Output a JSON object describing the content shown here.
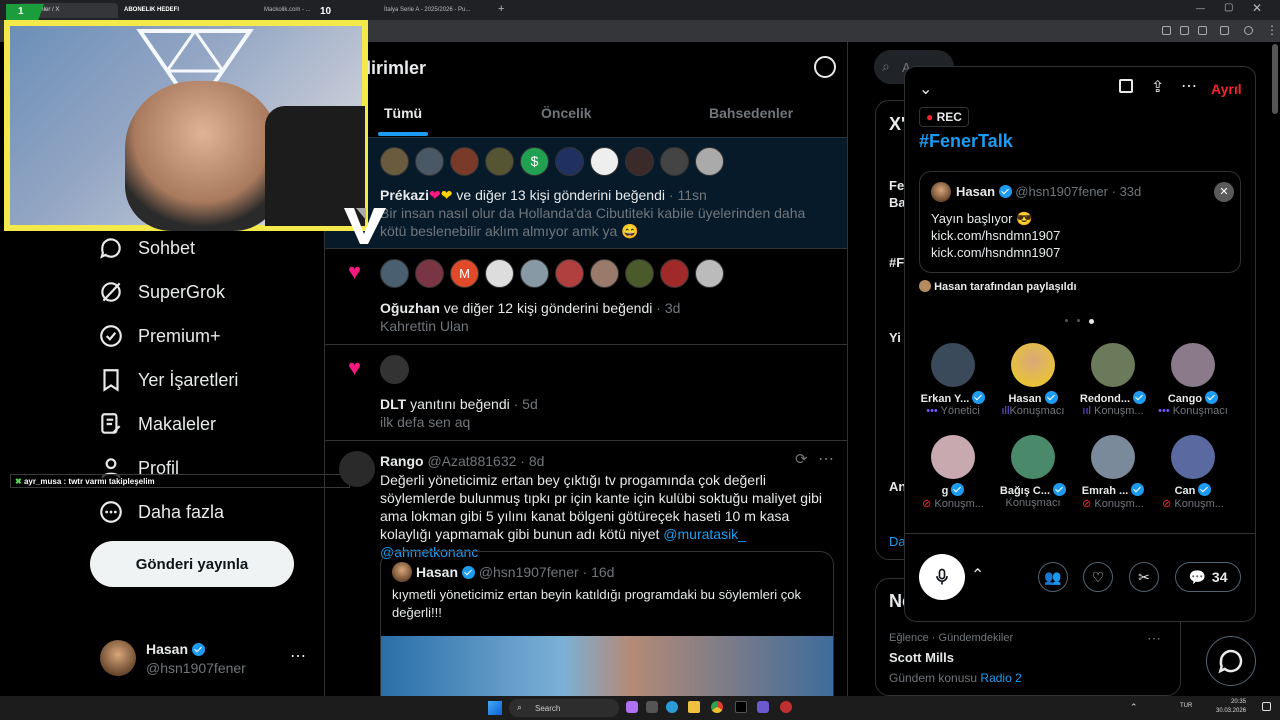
{
  "browser": {
    "tabs": [
      {
        "label": "Bildirimler / X"
      },
      {
        "label": "ABONELIK HEDEFI"
      },
      {
        "label": "Mackolik.com - ..."
      },
      {
        "label": "İtalya Serie A - 2025/2026 - Pu..."
      }
    ],
    "overlay_counter_left": "1",
    "overlay_counter_right": "10"
  },
  "nav": {
    "items": [
      {
        "label": "Sohbet",
        "icon": "chat-icon"
      },
      {
        "label": "SuperGrok",
        "icon": "grok-icon"
      },
      {
        "label": "Premium+",
        "icon": "premium-icon"
      },
      {
        "label": "Yer İşaretleri",
        "icon": "bookmark-icon"
      },
      {
        "label": "Makaleler",
        "icon": "article-icon"
      },
      {
        "label": "Profil",
        "icon": "profile-icon"
      },
      {
        "label": "Daha fazla",
        "icon": "more-icon"
      }
    ],
    "post_button": "Gönderi yayınla",
    "user": {
      "name": "Hasan",
      "handle": "@hsn1907fener"
    }
  },
  "chat_overlay": {
    "text": "ayr_musa : twtr varmı takipleşelim"
  },
  "feed": {
    "title": "dirimler",
    "tabs": [
      "Tümü",
      "Öncelik",
      "Bahsedenler"
    ],
    "notifications": [
      {
        "who": "Prékazi",
        "rest": " ve diğer 13 kişi gönderini beğendi",
        "time": "· 11sn",
        "text": "Bir insan nasıl olur da Hollanda'da Cibutiteki kabile üyelerinden daha kötü beslenebilir aklım almıyor amk ya 😄"
      },
      {
        "who": "Oğuzhan",
        "rest": " ve diğer 12 kişi gönderini beğendi",
        "time": "· 3d",
        "text": "Kahrettin Ulan"
      },
      {
        "who": "DLT",
        "rest": " yanıtını beğendi",
        "time": "· 5d",
        "text": "ilk defa sen aq"
      }
    ],
    "tweet": {
      "name": "Rango",
      "handle": "@Azat881632",
      "time": "· 8d",
      "text": "Değerli yöneticimiz ertan bey çıktığı tv progamında çok değerli söylemlerde bulunmuş tıpkı pr için kante için kulübi soktuğu maliyet gibi ama lokman gibi 5 yılını kanat bölgeni götüreçek haseti 10 m kasa kolaylığı yapmamak gibi bunun adı kötü niyet",
      "mentions": "@muratasik_ @ahmetkonanc",
      "quote": {
        "name": "Hasan",
        "handle": "@hsn1907fener",
        "time": "· 16d",
        "text": "kıymetli yöneticimiz ertan beyin katıldığı programdaki bu söylemleri çok değerli!!!"
      }
    }
  },
  "right_column": {
    "search_placeholder": "A",
    "snippets": [
      "X'",
      "Fe",
      "Ba",
      "#F",
      "Yi",
      "An",
      "Da",
      "Ne"
    ],
    "trend": {
      "meta": "Eğlence · Gündemdekiler",
      "title": "Scott Mills",
      "sub_prefix": "Gündem konusu",
      "sub_link": "Radio 2"
    }
  },
  "space": {
    "leave": "Ayrıl",
    "rec": "REC",
    "title": "#FenerTalk",
    "pinned": {
      "name": "Hasan",
      "handle": "@hsn1907fener",
      "time": "· 33d",
      "lines": [
        "Yayın başlıyor 😎",
        "kick.com/hsndmn1907",
        "kick.com/hsndmn1907"
      ]
    },
    "shared_by": "Hasan tarafından paylaşıldı",
    "speakers": [
      {
        "name": "Erkan Y...",
        "role": "Yönetici"
      },
      {
        "name": "Hasan",
        "role": "Konuşmacı"
      },
      {
        "name": "Redond...",
        "role": "Konuşm..."
      },
      {
        "name": "Cango",
        "role": "Konuşmacı"
      },
      {
        "name": "g",
        "role": "Konuşm..."
      },
      {
        "name": "Bağış C...",
        "role": "Konuşmacı"
      },
      {
        "name": "Emrah ...",
        "role": "Konuşm..."
      },
      {
        "name": "Can",
        "role": "Konuşm..."
      }
    ],
    "comments": "34"
  },
  "taskbar": {
    "search": "Search",
    "lang": "TUR",
    "time": "20:35",
    "date": "30.03.2026"
  },
  "colors": {
    "accent": "#1d9bf0",
    "like": "#f91880",
    "cam_border": "#f3e94a",
    "rec": "#f4212e"
  }
}
